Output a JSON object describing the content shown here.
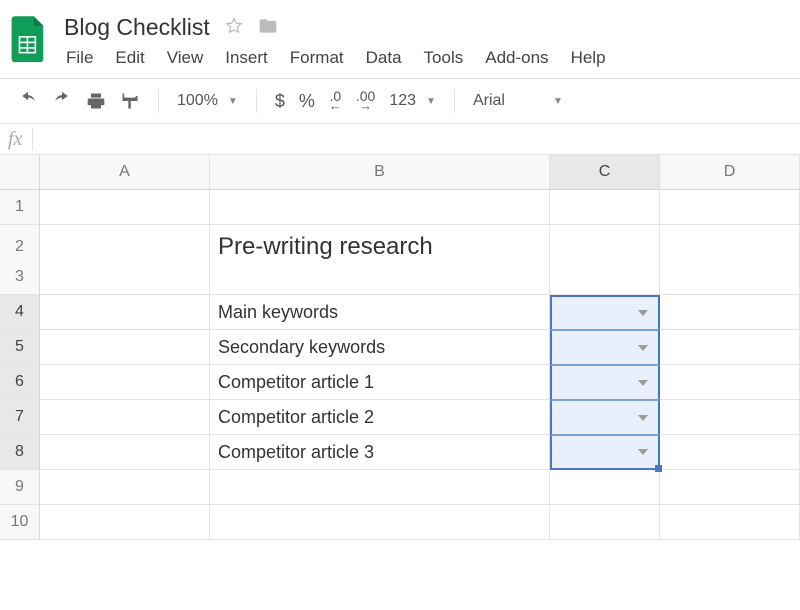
{
  "doc": {
    "title": "Blog Checklist"
  },
  "menus": [
    "File",
    "Edit",
    "View",
    "Insert",
    "Format",
    "Data",
    "Tools",
    "Add-ons",
    "Help"
  ],
  "toolbar": {
    "zoom": "100%",
    "currency": "$",
    "percent": "%",
    "dec_less": ".0",
    "dec_more": ".00",
    "num_format": "123",
    "font": "Arial"
  },
  "fx": {
    "label": "fx",
    "value": ""
  },
  "columns": [
    "A",
    "B",
    "C",
    "D"
  ],
  "rows": [
    "1",
    "2",
    "3",
    "4",
    "5",
    "6",
    "7",
    "8",
    "9",
    "10"
  ],
  "cells": {
    "B2": "Pre-writing research",
    "B4": "Main keywords",
    "B5": "Secondary keywords",
    "B6": "Competitor article 1",
    "B7": "Competitor article 2",
    "B8": "Competitor article 3"
  },
  "selected_column": "C",
  "selected_rows": [
    4,
    5,
    6,
    7,
    8
  ]
}
